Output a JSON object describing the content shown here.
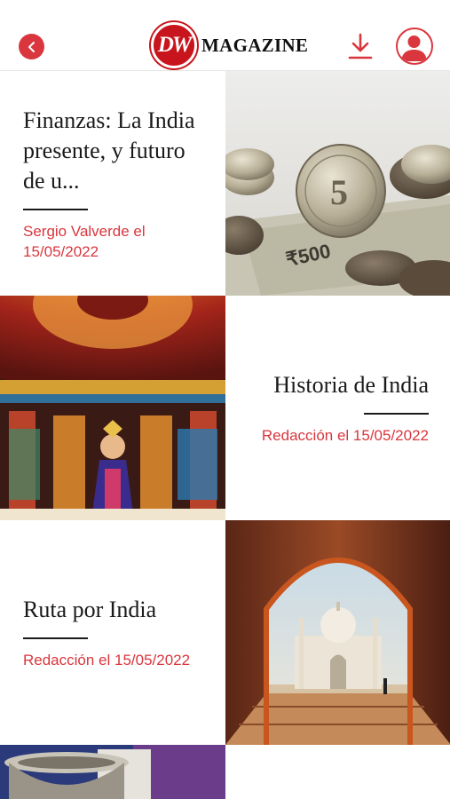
{
  "header": {
    "back_icon": "chevron-left-icon",
    "logo_mark": "DW",
    "logo_text": "MAGAZINE",
    "download_icon": "download-icon",
    "profile_icon": "user-icon",
    "accent_color": "#d9363e"
  },
  "articles": [
    {
      "title": "Finanzas: La India presente, y futuro de u...",
      "author_date": "Sergio Valverde el 15/05/2022",
      "image": "coins-and-rupee-notes"
    },
    {
      "title": "Historia de India",
      "author_date": "Redacción el 15/05/2022",
      "image": "indian-temple-shrine"
    },
    {
      "title": "Ruta por India",
      "author_date": "Redacción el 15/05/2022",
      "image": "taj-mahal-through-arch"
    },
    {
      "image": "brass-vessel"
    }
  ]
}
